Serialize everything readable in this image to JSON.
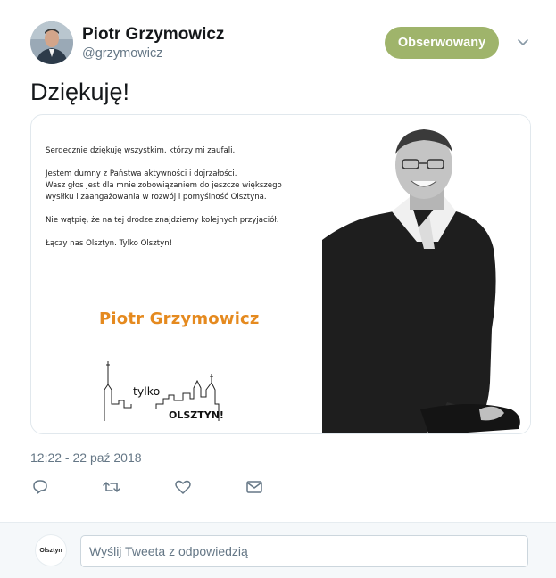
{
  "author": {
    "name": "Piotr Grzymowicz",
    "handle": "@grzymowicz"
  },
  "follow_button": {
    "label": "Obserwowany",
    "color": "#9fb46b"
  },
  "tweet": {
    "text": "Dziękuję!",
    "timestamp": "12:22 - 22 paź 2018"
  },
  "card_image": {
    "paragraphs": [
      "Serdecznie dziękuję wszystkim, którzy mi zaufali.",
      "Jestem dumny z Państwa aktywności i dojrzałości.\nWasz głos jest dla mnie zobowiązaniem do jeszcze większego\nwysiłku i zaangażowania w rozwój i pomyślność Olsztyna.",
      "Nie wątpię, że na tej drodze znajdziemy kolejnych przyjaciół.",
      "Łączy nas Olsztyn. Tylko Olsztyn!"
    ],
    "signature": "Piotr Grzymowicz",
    "signature_color": "#e58a1f",
    "logo_line1": "tylko",
    "logo_line2": "OLSZTYN!"
  },
  "actions": [
    {
      "icon": "reply-icon"
    },
    {
      "icon": "retweet-icon"
    },
    {
      "icon": "like-icon"
    },
    {
      "icon": "message-icon"
    }
  ],
  "reply": {
    "avatar_text": "Olsztyn",
    "placeholder": "Wyślij Tweeta z odpowiedzią"
  }
}
